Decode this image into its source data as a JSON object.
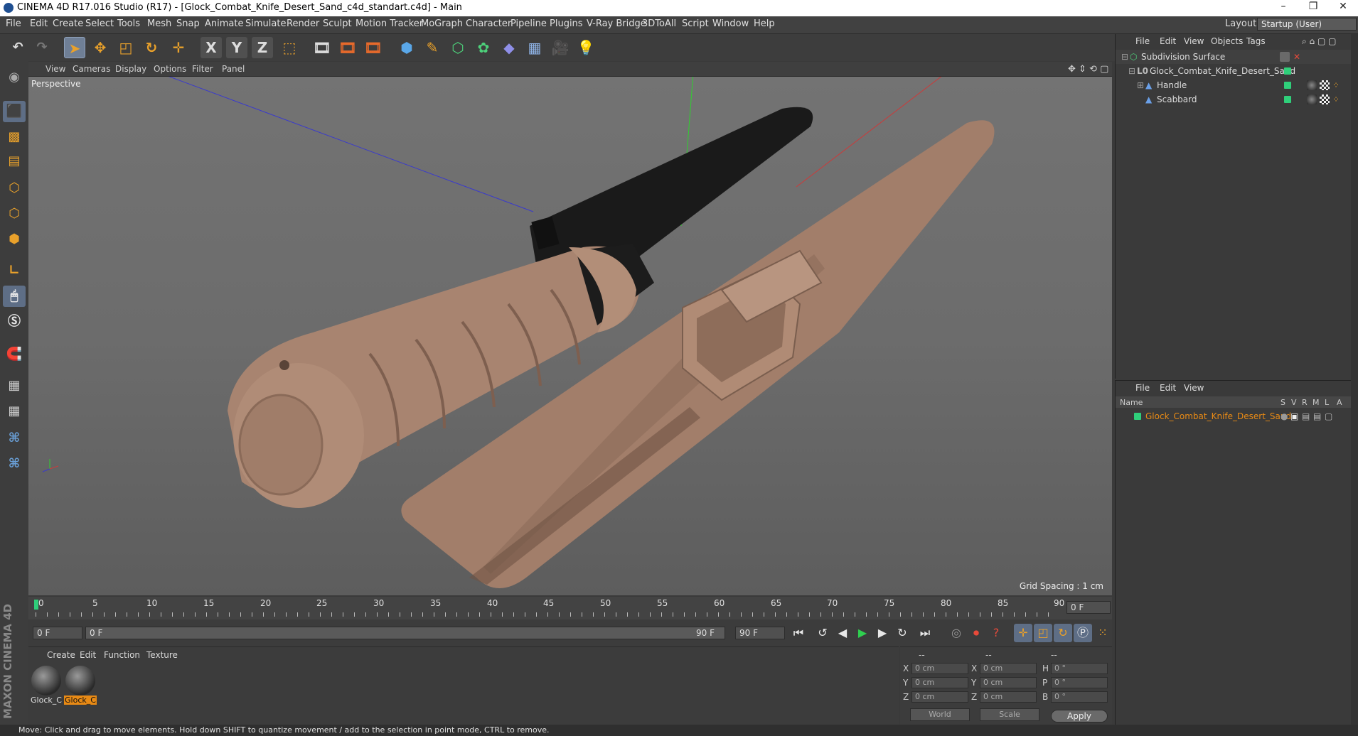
{
  "window": {
    "title": "CINEMA 4D R17.016 Studio (R17) - [Glock_Combat_Knife_Desert_Sand_c4d_standart.c4d] - Main",
    "minimize": "–",
    "restore": "❐",
    "close": "✕"
  },
  "menubar": {
    "items": [
      "File",
      "Edit",
      "Create",
      "Select",
      "Tools",
      "Mesh",
      "Snap",
      "Animate",
      "Simulate",
      "Render",
      "Sculpt",
      "Motion Tracker",
      "MoGraph",
      "Character",
      "Pipeline",
      "Plugins",
      "V-Ray Bridge",
      "3DToAll",
      "Script",
      "Window",
      "Help"
    ],
    "layout_label": "Layout:",
    "layout_value": "Startup (User)"
  },
  "toolbar": {
    "x_label": "X",
    "y_label": "Y",
    "z_label": "Z"
  },
  "viewport": {
    "menu": [
      "View",
      "Cameras",
      "Display",
      "Options",
      "Filter",
      "Panel"
    ],
    "camera_label": "Perspective",
    "grid_spacing": "Grid Spacing : 1 cm"
  },
  "timeline": {
    "ticks": [
      "0",
      "5",
      "10",
      "15",
      "20",
      "25",
      "30",
      "35",
      "40",
      "45",
      "50",
      "55",
      "60",
      "65",
      "70",
      "75",
      "80",
      "85",
      "90"
    ],
    "current_frame": "0 F",
    "start_frame": "0 F",
    "range_start": "0 F",
    "range_end": "90 F",
    "end_frame": "90 F"
  },
  "material_manager": {
    "menu": [
      "Create",
      "Edit",
      "Function",
      "Texture"
    ],
    "materials": [
      {
        "label": "Glock_C",
        "selected": false
      },
      {
        "label": "Glock_C",
        "selected": true
      }
    ]
  },
  "coordinates": {
    "header": [
      "--",
      "--",
      "--"
    ],
    "rows": [
      {
        "a": "X",
        "av": "0 cm",
        "b": "X",
        "bv": "0 cm",
        "c": "H",
        "cv": "0 °"
      },
      {
        "a": "Y",
        "av": "0 cm",
        "b": "Y",
        "bv": "0 cm",
        "c": "P",
        "cv": "0 °"
      },
      {
        "a": "Z",
        "av": "0 cm",
        "b": "Z",
        "bv": "0 cm",
        "c": "B",
        "cv": "0 °"
      }
    ],
    "space_select": "World",
    "mode_select": "Scale",
    "apply": "Apply"
  },
  "object_manager": {
    "menu": [
      "File",
      "Edit",
      "View",
      "Objects",
      "Tags"
    ],
    "objects": [
      {
        "name": "Subdivision Surface"
      },
      {
        "name": "Glock_Combat_Knife_Desert_Sand"
      },
      {
        "name": "Handle"
      },
      {
        "name": "Scabbard"
      }
    ]
  },
  "attribute_manager": {
    "menu": [
      "File",
      "Edit",
      "View"
    ],
    "columns": {
      "name": "Name",
      "s": "S",
      "v": "V",
      "r": "R",
      "m": "M",
      "l": "L",
      "a": "A"
    },
    "row_name": "Glock_Combat_Knife_Desert_Sand"
  },
  "branding": {
    "logo": "MAXON CINEMA 4D"
  },
  "status": {
    "text": "Move: Click and drag to move elements. Hold down SHIFT to quantize movement / add to the selection in point mode, CTRL to remove."
  },
  "colors": {
    "accent_orange": "#e88a15",
    "tag_green": "#2fcf7a",
    "knife_tan": "#9c7a66",
    "viewport_bg": "#6c6c6c"
  }
}
